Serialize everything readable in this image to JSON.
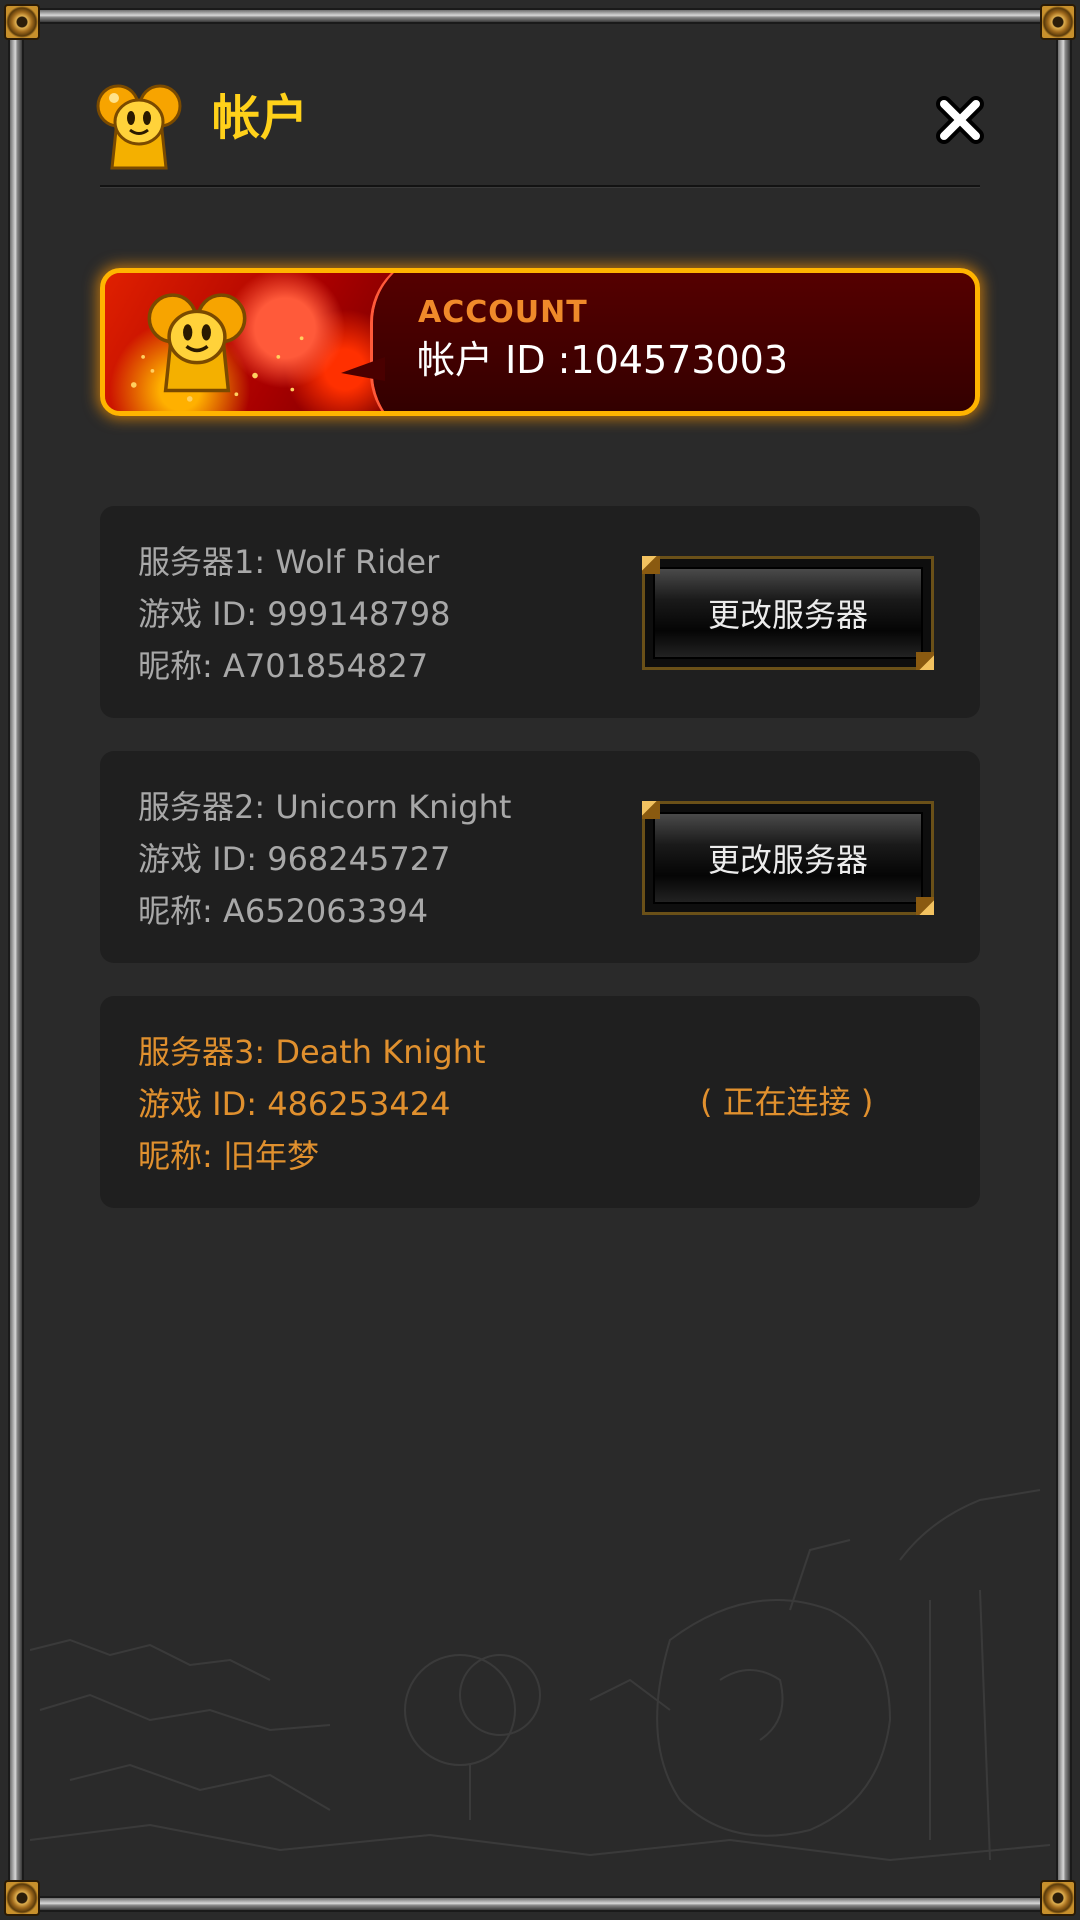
{
  "header": {
    "title": "帐户",
    "icon": "mascot-icon",
    "close_icon": "close-icon"
  },
  "banner": {
    "label": "ACCOUNT",
    "account_id": "帐户 ID :104573003",
    "mascot_icon": "mascot-icon"
  },
  "servers": [
    {
      "server": "服务器1: Wolf Rider",
      "game_id": "游戏 ID: 999148798",
      "nickname": "昵称: A701854827",
      "button_label": "更改服务器"
    },
    {
      "server": "服务器2: Unicorn Knight",
      "game_id": "游戏 ID: 968245727",
      "nickname": "昵称: A652063394",
      "button_label": "更改服务器"
    },
    {
      "server": "服务器3: Death Knight",
      "game_id": "游戏 ID: 486253424",
      "nickname": "昵称: 旧年梦",
      "status": "( 正在连接 )"
    }
  ],
  "colors": {
    "title": "#ffd11a",
    "active": "#e0902e",
    "inactive": "#a8a8a8",
    "banner_border": "#ffb400"
  }
}
